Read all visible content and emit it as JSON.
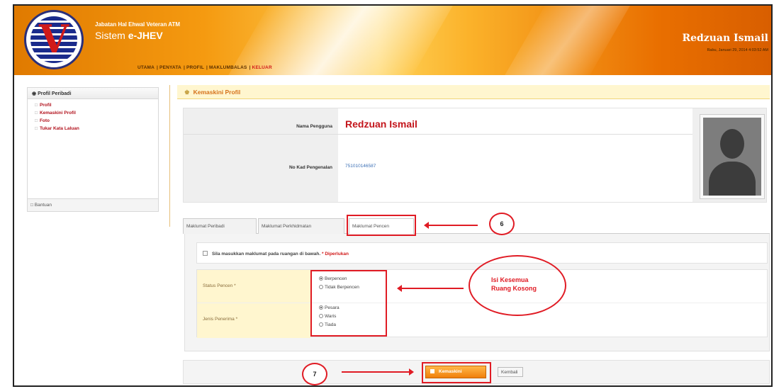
{
  "header": {
    "org_name": "Jabatan Hal Ehwal Veteran ATM",
    "system_prefix": "Sistem ",
    "system_name": "e-JHEV",
    "menu": [
      "UTAMA",
      "PENYATA",
      "PROFIL",
      "MAKLUMBALAS"
    ],
    "menu_active": "KELUAR",
    "user_name": "Redzuan Ismail",
    "date_time": "Rabu, Januari 29, 2014 4:03:52 AM"
  },
  "sidebar": {
    "title": "Profil Peribadi",
    "items": [
      "Profil",
      "Kemaskini Profil",
      "Foto",
      "Tukar Kata Laluan"
    ],
    "help": "Bantuan"
  },
  "page": {
    "title": "Kemaskini Profil"
  },
  "profile": {
    "name_label": "Nama Pengguna",
    "name_value": "Redzuan Ismail",
    "id_label": "No Kad Pengenalan",
    "id_value": "751010146587"
  },
  "tabs": [
    "Maklumat Peribadi",
    "Maklumat Perkhidmatan",
    "Maklumat Pencen"
  ],
  "form": {
    "notice": "Sila masukkan maklumat pada ruangan di bawah.",
    "required_note": "* Diperlukan",
    "status_label": "Status Pencen *",
    "status_options": [
      "Berpencen",
      "Tidak Berpencen"
    ],
    "status_selected": "Berpencen",
    "type_label": "Jenis Penerima *",
    "type_options": [
      "Pesara",
      "Waris",
      "Tiada"
    ],
    "type_selected": "Pesara"
  },
  "buttons": {
    "save": "Kemaskini",
    "back": "Kembali"
  },
  "annotations": {
    "step_6": "6",
    "step_7": "7",
    "callout_line1": "Isi Kesemua",
    "callout_line2": "Ruang Kosong"
  },
  "colors": {
    "accent": "#f07f0a",
    "annotation": "#e01b24",
    "name_red": "#c3151b"
  }
}
